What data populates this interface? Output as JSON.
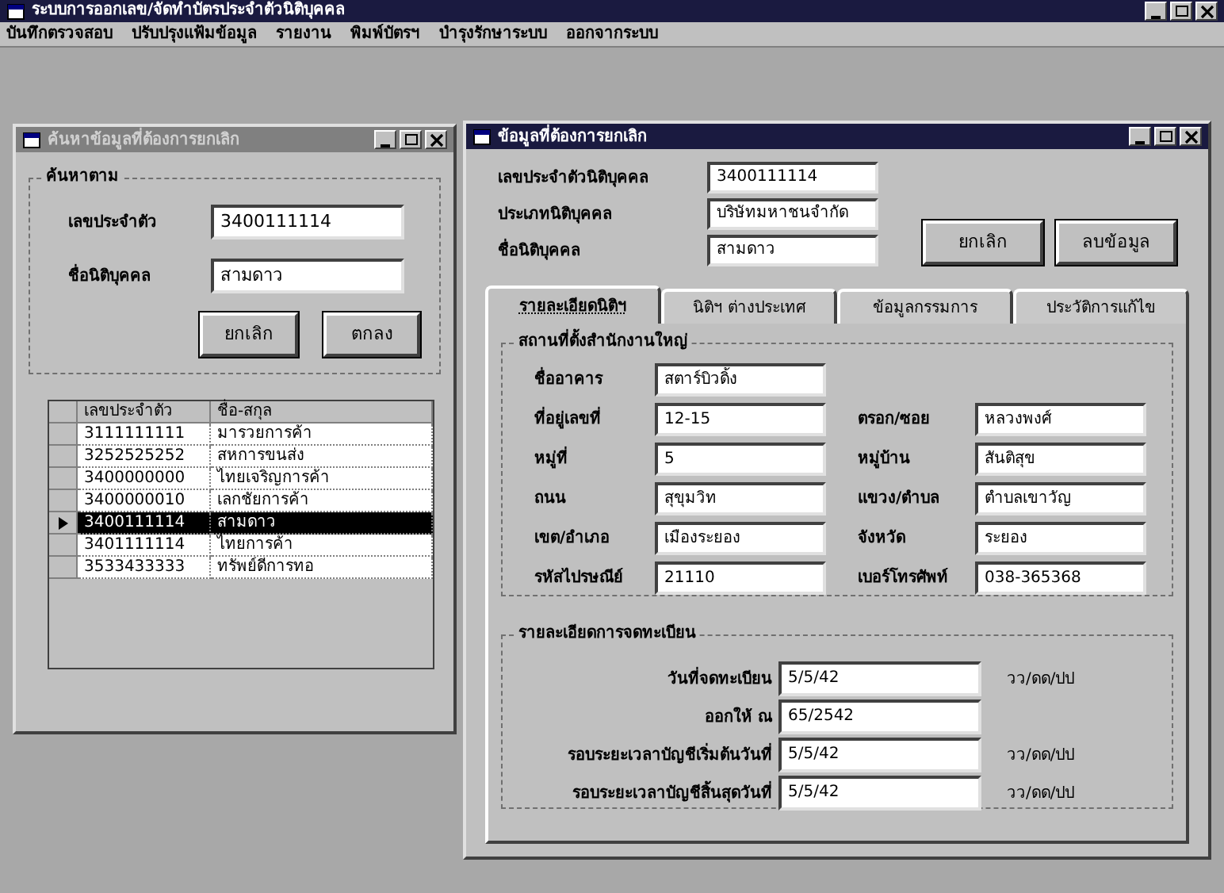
{
  "window": {
    "title": "ระบบการออกเลข/จัดทำบัตรประจำตัวนิติบุคคล"
  },
  "menu": [
    "บันทึกตรวจสอบ",
    "ปรับปรุงแฟ้มข้อมูล",
    "รายงาน",
    "พิมพ์บัตรฯ",
    "บำรุงรักษาระบบ",
    "ออกจากระบบ"
  ],
  "search_window": {
    "title": "ค้นหาข้อมูลที่ต้องการยกเลิก",
    "group": "ค้นหาตาม",
    "fields": [
      {
        "label": "เลขประจำตัว",
        "value": "3400111114"
      },
      {
        "label": "ชื่อนิติบุคคล",
        "value": "สามดาว"
      }
    ],
    "buttons": [
      "ยกเลิก",
      "ตกลง"
    ],
    "table": {
      "columns": [
        "เลขประจำตัว",
        "ชื่อ-สกุล"
      ],
      "rows": [
        {
          "cells": [
            "3111111111",
            "มารวยการค้า"
          ],
          "selected": false
        },
        {
          "cells": [
            "3252525252",
            "สหการขนส่ง"
          ],
          "selected": false
        },
        {
          "cells": [
            "3400000000",
            "ไทยเจริญการค้า"
          ],
          "selected": false
        },
        {
          "cells": [
            "3400000010",
            "เลกชัยการค้า"
          ],
          "selected": false
        },
        {
          "cells": [
            "3400111114",
            "สามดาว"
          ],
          "selected": true
        },
        {
          "cells": [
            "3401111114",
            "ไทยการค้า"
          ],
          "selected": false
        },
        {
          "cells": [
            "3533433333",
            "ทรัพย์ดีการทอ"
          ],
          "selected": false
        }
      ]
    }
  },
  "detail_window": {
    "title": "ข้อมูลที่ต้องการยกเลิก",
    "fields": [
      {
        "label": "เลขประจำตัวนิติบุคคล",
        "value": "3400111114"
      },
      {
        "label": "ประเภทนิติบุคคล",
        "value": "บริษัทมหาชนจำกัด"
      },
      {
        "label": "ชื่อนิติบุคคล",
        "value": "สามดาว"
      }
    ],
    "buttons": [
      "ยกเลิก",
      "ลบข้อมูล"
    ],
    "tabs": [
      {
        "label": "รายละเอียดนิติฯ",
        "selected": true
      },
      {
        "label": "นิติฯ ต่างประเทศ",
        "selected": false
      },
      {
        "label": "ข้อมูลกรรมการ",
        "selected": false
      },
      {
        "label": "ประวัติการแก้ไข",
        "selected": false
      }
    ],
    "address_group": {
      "title": "สถานที่ตั้งสำนักงานใหญ่",
      "rows": [
        [
          {
            "label": "ชื่ออาคาร",
            "value": "สตาร์บิวดิ้ง"
          }
        ],
        [
          {
            "label": "ที่อยู่เลขที่",
            "value": "12-15"
          },
          {
            "label": "ตรอก/ซอย",
            "value": "หลวงพงศ์"
          }
        ],
        [
          {
            "label": "หมู่ที่",
            "value": "5"
          },
          {
            "label": "หมู่บ้าน",
            "value": "สันติสุข"
          }
        ],
        [
          {
            "label": "ถนน",
            "value": "สุขุมวิท"
          },
          {
            "label": "แขวง/ตำบล",
            "value": "ตำบลเขาวัญ"
          }
        ],
        [
          {
            "label": "เขต/อำเภอ",
            "value": "เมืองระยอง"
          },
          {
            "label": "จังหวัด",
            "value": "ระยอง"
          }
        ],
        [
          {
            "label": "รหัสไปรษณีย์",
            "value": "21110"
          },
          {
            "label": "เบอร์โทรศัพท์",
            "value": "038-365368"
          }
        ]
      ]
    },
    "registration_group": {
      "title": "รายละเอียดการจดทะเบียน",
      "rows": [
        {
          "label": "วันที่จดทะเบียน",
          "value": "5/5/42",
          "hint": "วว/ดด/ปป"
        },
        {
          "label": "ออกให้ ณ",
          "value": "65/2542"
        },
        {
          "label": "รอบระยะเวลาบัญชีเริ่มต้นวันที่",
          "value": "5/5/42",
          "hint": "วว/ดด/ปป"
        },
        {
          "label": "รอบระยะเวลาบัญชีสิ้นสุดวันที่",
          "value": "5/5/42",
          "hint": "วว/ดด/ปป"
        }
      ]
    }
  }
}
